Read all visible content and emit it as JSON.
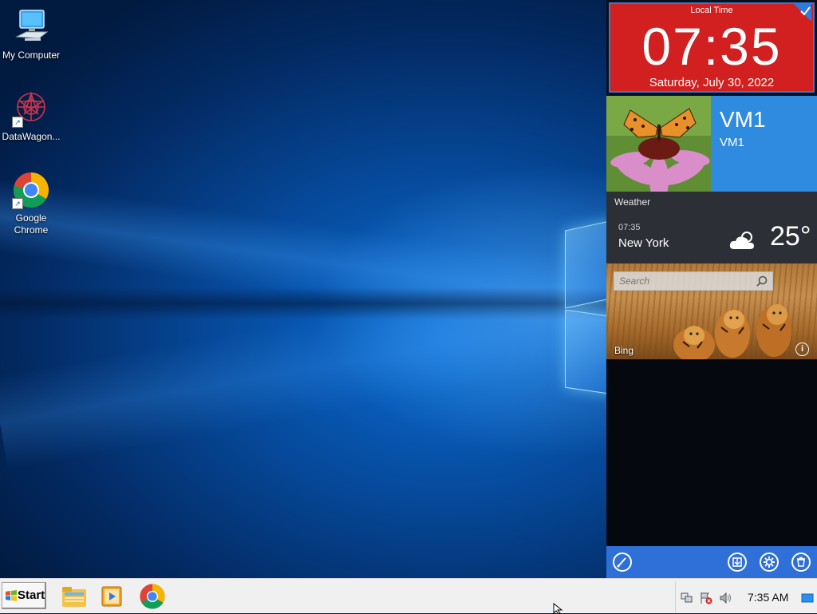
{
  "desktop": {
    "icons": [
      {
        "label": "My Computer",
        "icon": "computer-icon"
      },
      {
        "label": "DataWagon...",
        "icon": "datawagon-icon"
      },
      {
        "label": "Google Chrome",
        "icon": "chrome-icon"
      }
    ]
  },
  "side_panel": {
    "clock": {
      "label": "Local Time",
      "time": "07:35",
      "date": "Saturday, July 30, 2022"
    },
    "user": {
      "name": "VM1",
      "subtitle": "VM1"
    },
    "weather": {
      "title": "Weather",
      "time": "07:35",
      "city": "New York",
      "temp": "25°",
      "condition_icon": "cloud-sun-icon"
    },
    "bing": {
      "search_placeholder": "Search",
      "label": "Bing"
    },
    "toolbar": {
      "buttons": [
        "brush-icon",
        "save-icon",
        "gear-icon",
        "trash-icon"
      ]
    }
  },
  "taskbar": {
    "start_label": "Start",
    "apps": [
      "file-explorer-icon",
      "media-player-icon",
      "chrome-icon"
    ],
    "tray_icons": [
      "network-icon",
      "security-alert-icon",
      "volume-icon"
    ],
    "clock": "7:35 AM",
    "show_desktop_icon": "show-desktop-icon"
  },
  "colors": {
    "clock_tile": "#d21f1f",
    "user_tile": "#2f8be0",
    "weather_tile": "#2c2f35",
    "panel_toolbar": "#2f6fd8"
  }
}
